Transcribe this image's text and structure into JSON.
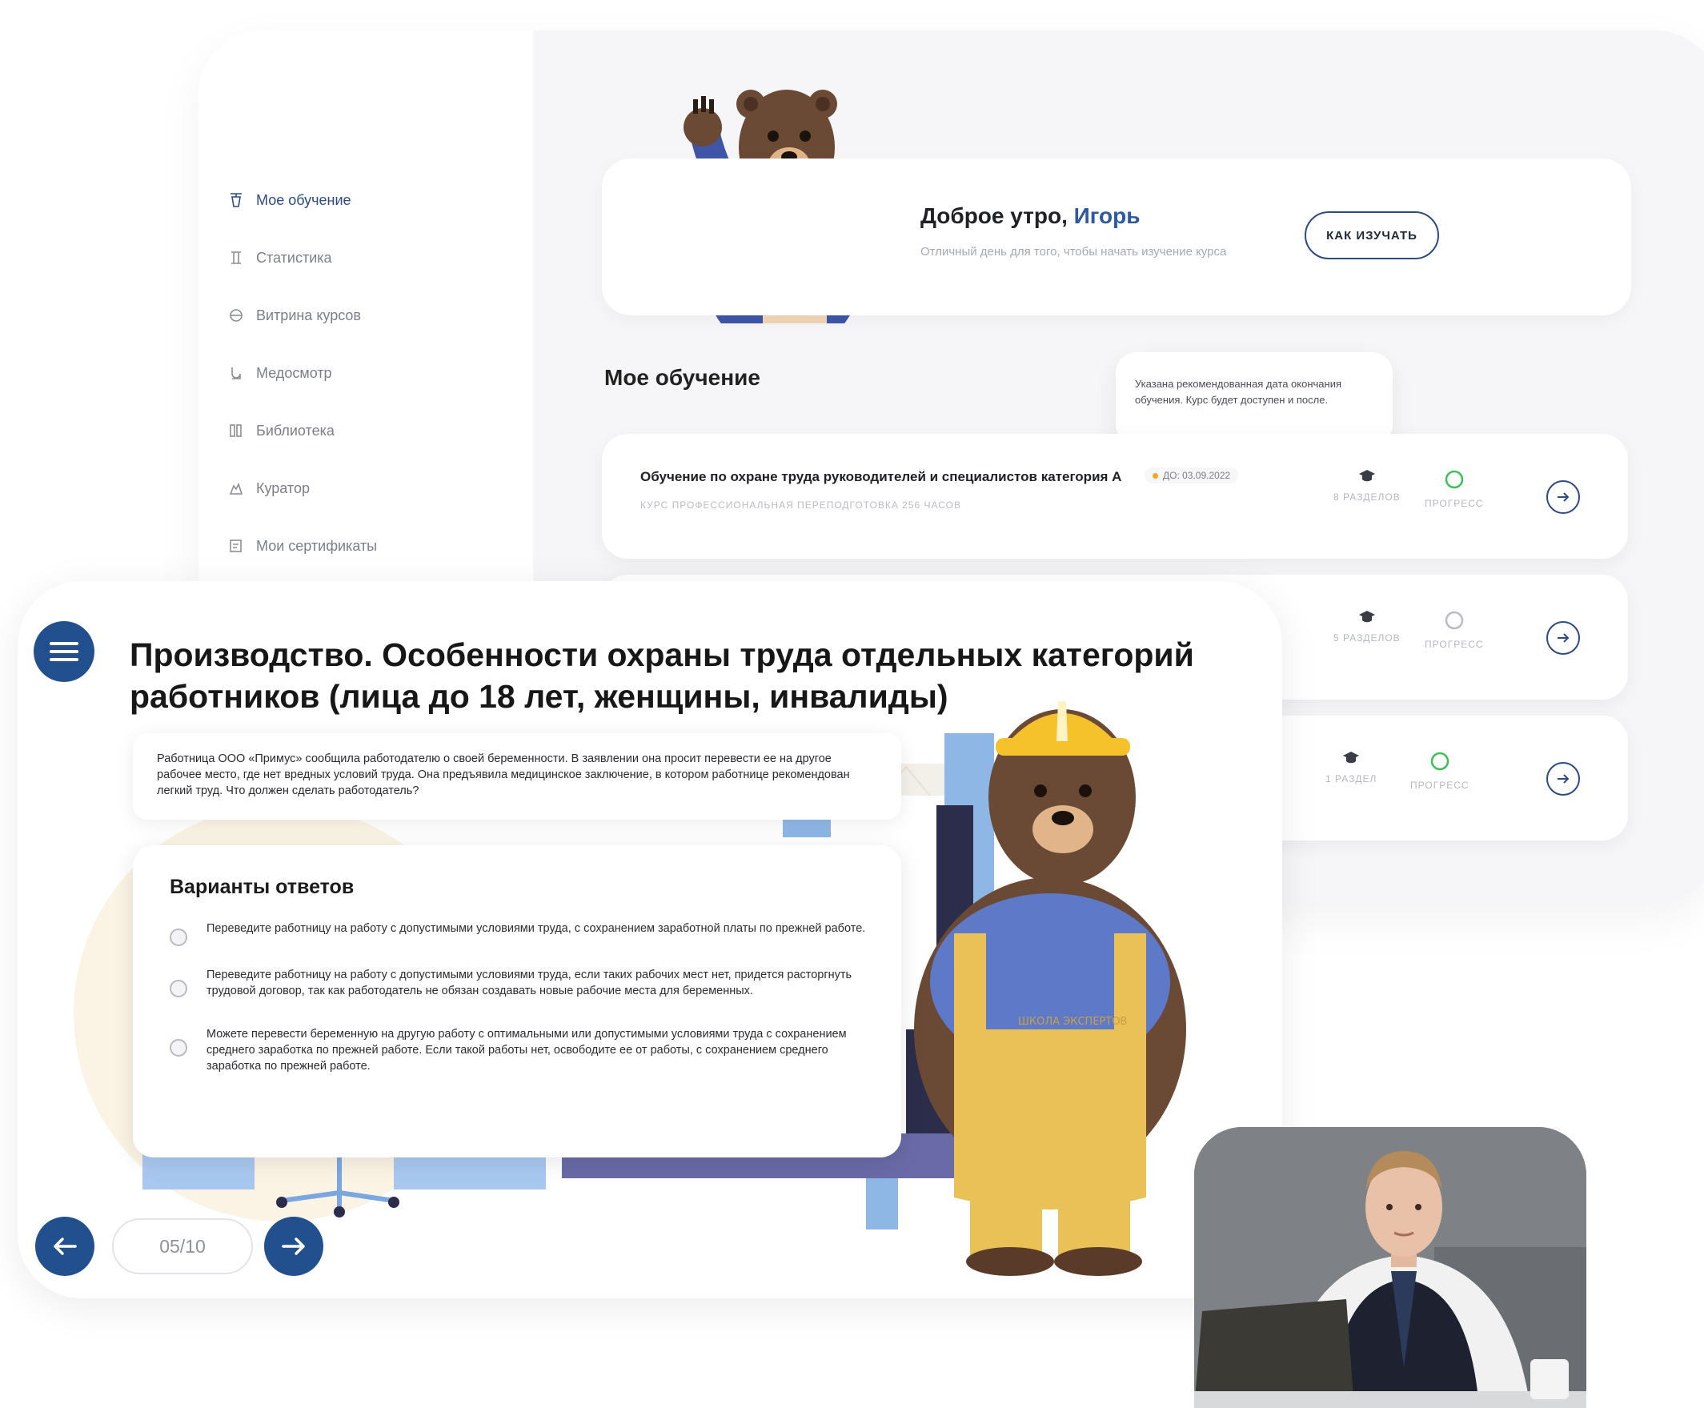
{
  "sidebar": {
    "items": [
      {
        "label": "Мое обучение",
        "icon": "graduation-cap-icon",
        "active": true
      },
      {
        "label": "Статистика",
        "icon": "statistics-icon",
        "active": false
      },
      {
        "label": "Витрина курсов",
        "icon": "courses-showcase-icon",
        "active": false
      },
      {
        "label": "Медосмотр",
        "icon": "medical-checkup-icon",
        "active": false
      },
      {
        "label": "Библиотека",
        "icon": "library-icon",
        "active": false
      },
      {
        "label": "Куратор",
        "icon": "curator-icon",
        "active": false
      },
      {
        "label": "Мои сертификаты",
        "icon": "certificates-icon",
        "active": false
      }
    ]
  },
  "greeting": {
    "prefix": "Доброе утро, ",
    "name": "Игорь",
    "subtitle": "Отличный день для того, чтобы начать изучение курса",
    "how_button": "КАК ИЗУЧАТЬ"
  },
  "learning": {
    "title": "Мое обучение",
    "tooltip": "Указана рекомендованная дата окончания обучения. Курс будет доступен и после.",
    "courses": [
      {
        "title": "Обучение по охране труда руководителей и специалистов категория А",
        "date": "ДО: 03.09.2022",
        "meta": "КУРС   ПРОФЕССИОНАЛЬНАЯ ПЕРЕПОДГОТОВКА   256 ЧАСОВ",
        "sections": "8 РАЗДЕЛОВ",
        "progress_label": "ПРОГРЕСС",
        "progress_color": "#3fbf5a"
      },
      {
        "sections": "5 РАЗДЕЛОВ",
        "progress_label": "ПРОГРЕСС",
        "progress_color": "#b9bcc3"
      },
      {
        "sections": "1 РАЗДЕЛ",
        "progress_label": "ПРОГРЕСС",
        "progress_color": "#3fbf5a"
      }
    ]
  },
  "quiz": {
    "title": "Производство. Особенности охраны труда отдельных категорий работников (лица до 18 лет, женщины, инвалиды)",
    "question": "Работница ООО «Примус» сообщила работодателю о своей беременности. В заявлении она просит перевести ее на другое рабочее место, где нет вредных условий труда. Она предъявила медицинское заключение, в котором работнице рекомендован легкий труд. Что должен сделать работодатель?",
    "answers_title": "Варианты ответов",
    "options": [
      "Переведите работницу на работу с допустимыми условиями труда, с сохранением заработной платы по прежней работе.",
      "Переведите работницу на работу с допустимыми условиями труда, если таких рабочих мест нет, придется расторгнуть трудовой договор, так как работодатель не обязан создавать новые рабочие места для беременных.",
      "Можете перевести беременную на другую работу с оптимальными или допустимыми условиями труда с сохранением среднего заработка по прежней работе. Если такой работы нет, освободите ее от работы, с сохранением среднего заработка по прежней работе."
    ],
    "page_counter": "05/10",
    "helmet_text": "ШКОЛА ЭКСПЕРТОВ"
  },
  "colors": {
    "brand_blue": "#22508f",
    "accent_name": "#2d58a3",
    "bear_brown": "#6b4a35",
    "sweater_blue": "#3f55a8",
    "helmet_yellow": "#f6c22c",
    "overalls_yellow": "#e9c157"
  }
}
